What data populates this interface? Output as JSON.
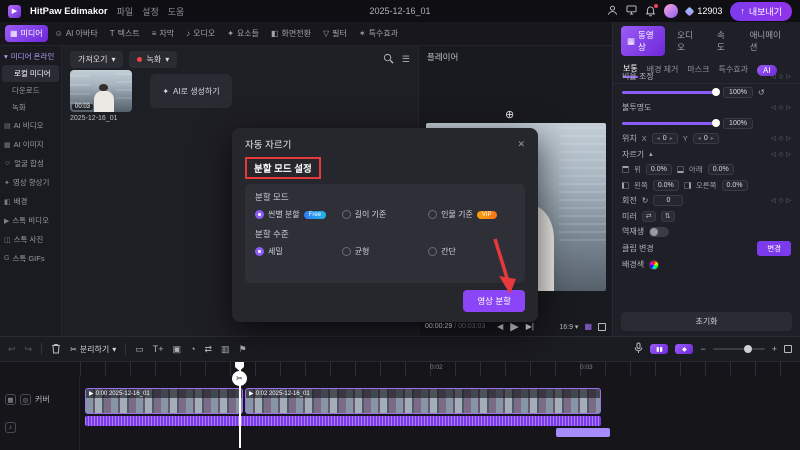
{
  "topbar": {
    "app_name": "HitPaw Edimakor",
    "menu_file": "파일",
    "menu_settings": "설정",
    "menu_help": "도움",
    "project_title": "2025-12-16_01",
    "coin_count": "12903",
    "export_label": "내보내기"
  },
  "tabs": [
    {
      "label": "미디어"
    },
    {
      "label": "AI 아바타"
    },
    {
      "label": "텍스트"
    },
    {
      "label": "자막"
    },
    {
      "label": "오디오"
    },
    {
      "label": "요소들"
    },
    {
      "label": "화면전환"
    },
    {
      "label": "필터"
    },
    {
      "label": "특수효과"
    }
  ],
  "sidebar": {
    "root": "미디어 온라인",
    "items": [
      {
        "label": "로컬 미디어"
      },
      {
        "label": "다운로드"
      },
      {
        "label": "녹화"
      }
    ],
    "sections": [
      {
        "label": "AI 비디오"
      },
      {
        "label": "AI 이미지"
      },
      {
        "label": "얼굴 합성"
      },
      {
        "label": "영상 향상기"
      },
      {
        "label": "배경"
      },
      {
        "label": "스톡 비디오"
      },
      {
        "label": "스톡 사진"
      },
      {
        "label": "스톡 GIFs"
      }
    ]
  },
  "media": {
    "import_label": "가져오기",
    "record_label": "녹화",
    "clip_duration": "00:03",
    "clip_name": "2025-12-16_01",
    "ai_generate": "AI로 생성하기"
  },
  "player": {
    "title": "플레이어",
    "current_time": "00:00:29",
    "total_time": "/ 00:03:03",
    "ratio": "16:9"
  },
  "dialog": {
    "title": "자동 자르기",
    "close": "✕",
    "section_title": "분할 모드 설정",
    "mode_label": "분할 모드",
    "modes": [
      {
        "label": "씬별 분할",
        "badge": "Free"
      },
      {
        "label": "길이 기준"
      },
      {
        "label": "인물 기준",
        "badge": "VIP"
      }
    ],
    "level_label": "분할 수준",
    "levels": [
      {
        "label": "세밀"
      },
      {
        "label": "균형"
      },
      {
        "label": "간단"
      }
    ],
    "action_label": "영상 분할"
  },
  "right_panel": {
    "tabs": [
      {
        "label": "동영상"
      },
      {
        "label": "오디오"
      },
      {
        "label": "속도"
      },
      {
        "label": "애니메이션"
      }
    ],
    "subtabs": [
      {
        "label": "보통"
      },
      {
        "label": "배경 제거"
      },
      {
        "label": "마스크"
      },
      {
        "label": "특수효과"
      },
      {
        "label": "AI"
      }
    ],
    "scale_label": "비율 조정",
    "scale_value": "100%",
    "opacity_label": "불투명도",
    "opacity_value": "100%",
    "position_label": "위치",
    "x_label": "X",
    "x_value": "0",
    "y_label": "Y",
    "y_value": "0",
    "crop_label": "자르기",
    "crop": [
      {
        "label": "위",
        "value": "0.0%"
      },
      {
        "label": "아래",
        "value": "0.0%"
      },
      {
        "label": "왼쪽",
        "value": "0.0%"
      },
      {
        "label": "오른쪽",
        "value": "0.0%"
      }
    ],
    "rotate_label": "회전",
    "rotate_value": "0",
    "mirror_label": "미러",
    "reverse_label": "역재생",
    "clip_change_label": "클립 변경",
    "change_button": "변경",
    "bg_label": "배경색",
    "reset_label": "초기화"
  },
  "timeline_toolbar": {
    "split_label": "분리하기"
  },
  "timeline": {
    "cover_label": "커버",
    "marker1": "0:02",
    "marker2": "0:03",
    "clip1_label": "0:00 2025-12-16_01",
    "clip2_label": "0:02 2025-12-16_01"
  },
  "colors": {
    "accent": "#8b5cf6",
    "annotation": "#e5393c"
  }
}
